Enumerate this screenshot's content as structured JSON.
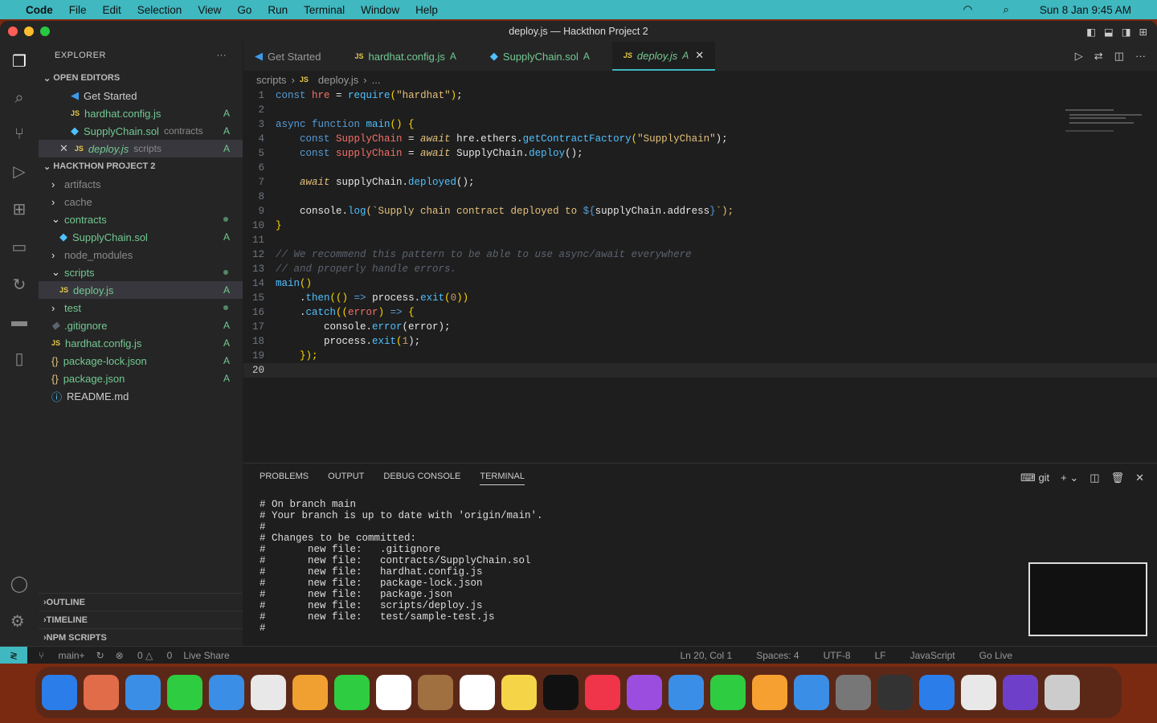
{
  "menubar": {
    "app": "Code",
    "items": [
      "File",
      "Edit",
      "Selection",
      "View",
      "Go",
      "Run",
      "Terminal",
      "Window",
      "Help"
    ],
    "datetime": "Sun 8 Jan  9:45 AM"
  },
  "window": {
    "title": "deploy.js — Hackthon Project 2"
  },
  "explorer": {
    "title": "EXPLORER",
    "open_editors_label": "OPEN EDITORS",
    "open_editors": [
      {
        "name": "Get Started",
        "icon": "vscode-icon",
        "badge": ""
      },
      {
        "name": "hardhat.config.js",
        "icon": "js",
        "badge": "A"
      },
      {
        "name": "SupplyChain.sol",
        "icon": "sol",
        "badge": "A",
        "desc": "contracts"
      },
      {
        "name": "deploy.js",
        "icon": "js",
        "badge": "A",
        "desc": "scripts"
      }
    ],
    "project_label": "HACKTHON PROJECT 2",
    "tree": [
      {
        "name": "artifacts",
        "type": "folder",
        "depth": 1
      },
      {
        "name": "cache",
        "type": "folder",
        "depth": 1
      },
      {
        "name": "contracts",
        "type": "folder-open",
        "depth": 1,
        "dot": true
      },
      {
        "name": "SupplyChain.sol",
        "type": "sol",
        "depth": 2,
        "badge": "A"
      },
      {
        "name": "node_modules",
        "type": "folder",
        "depth": 1
      },
      {
        "name": "scripts",
        "type": "folder-open",
        "depth": 1,
        "dot": true
      },
      {
        "name": "deploy.js",
        "type": "js",
        "depth": 2,
        "badge": "A"
      },
      {
        "name": "test",
        "type": "folder",
        "depth": 1,
        "dot": true
      },
      {
        "name": ".gitignore",
        "type": "git",
        "depth": 1,
        "badge": "A"
      },
      {
        "name": "hardhat.config.js",
        "type": "js",
        "depth": 1,
        "badge": "A"
      },
      {
        "name": "package-lock.json",
        "type": "json",
        "depth": 1,
        "badge": "A"
      },
      {
        "name": "package.json",
        "type": "json",
        "depth": 1,
        "badge": "A"
      },
      {
        "name": "README.md",
        "type": "info",
        "depth": 1
      }
    ],
    "bottom_sections": [
      "OUTLINE",
      "TIMELINE",
      "NPM SCRIPTS"
    ]
  },
  "tabs": [
    {
      "label": "Get Started",
      "icon": "vscode-icon"
    },
    {
      "label": "hardhat.config.js",
      "badge": "A",
      "icon": "js"
    },
    {
      "label": "SupplyChain.sol",
      "badge": "A",
      "icon": "sol"
    },
    {
      "label": "deploy.js",
      "badge": "A",
      "icon": "js",
      "active": true
    }
  ],
  "breadcrumb": [
    "scripts",
    "deploy.js",
    "..."
  ],
  "code": [
    [
      [
        "const ",
        "k"
      ],
      [
        "hre",
        "v"
      ],
      [
        " = ",
        "w"
      ],
      [
        "require",
        "f"
      ],
      [
        "(",
        "p"
      ],
      [
        "\"hardhat\"",
        "s"
      ],
      [
        ")",
        "p"
      ],
      [
        ";",
        "w"
      ]
    ],
    [],
    [
      [
        "async ",
        "k"
      ],
      [
        "function ",
        "k"
      ],
      [
        "main",
        "f"
      ],
      [
        "() {",
        "p"
      ]
    ],
    [
      [
        "    const ",
        "k"
      ],
      [
        "SupplyChain",
        "v"
      ],
      [
        " = ",
        "w"
      ],
      [
        "await ",
        "it"
      ],
      [
        "hre.ethers.",
        "w"
      ],
      [
        "getContractFactory",
        "f"
      ],
      [
        "(",
        "p"
      ],
      [
        "\"SupplyChain\"",
        "s"
      ],
      [
        ");",
        "w"
      ]
    ],
    [
      [
        "    const ",
        "k"
      ],
      [
        "supplyChain",
        "v"
      ],
      [
        " = ",
        "w"
      ],
      [
        "await ",
        "it"
      ],
      [
        "SupplyChain.",
        "w"
      ],
      [
        "deploy",
        "f"
      ],
      [
        "();",
        "w"
      ]
    ],
    [],
    [
      [
        "    await ",
        "it"
      ],
      [
        "supplyChain.",
        "w"
      ],
      [
        "deployed",
        "f"
      ],
      [
        "();",
        "w"
      ]
    ],
    [],
    [
      [
        "    console.",
        "w"
      ],
      [
        "log",
        "f"
      ],
      [
        "(`Supply chain contract deployed to ",
        "s"
      ],
      [
        "${",
        "k"
      ],
      [
        "supplyChain.address",
        "w"
      ],
      [
        "}",
        "k"
      ],
      [
        "`);",
        "s"
      ]
    ],
    [
      [
        "}",
        "p"
      ]
    ],
    [],
    [
      [
        "// We recommend this pattern to be able to use async/await everywhere",
        "c"
      ]
    ],
    [
      [
        "// and properly handle errors.",
        "c"
      ]
    ],
    [
      [
        "main",
        "f"
      ],
      [
        "()",
        "p"
      ]
    ],
    [
      [
        "    .",
        "w"
      ],
      [
        "then",
        "f"
      ],
      [
        "(() ",
        "p"
      ],
      [
        "=> ",
        "k"
      ],
      [
        "process.",
        "w"
      ],
      [
        "exit",
        "f"
      ],
      [
        "(",
        "p"
      ],
      [
        "0",
        "n"
      ],
      [
        "))",
        "p"
      ]
    ],
    [
      [
        "    .",
        "w"
      ],
      [
        "catch",
        "f"
      ],
      [
        "((",
        "p"
      ],
      [
        "error",
        "v"
      ],
      [
        ") ",
        "p"
      ],
      [
        "=> ",
        "k"
      ],
      [
        "{",
        "p"
      ]
    ],
    [
      [
        "        console.",
        "w"
      ],
      [
        "error",
        "f"
      ],
      [
        "(error);",
        "w"
      ]
    ],
    [
      [
        "        process.",
        "w"
      ],
      [
        "exit",
        "f"
      ],
      [
        "(",
        "p"
      ],
      [
        "1",
        "n"
      ],
      [
        ");",
        "w"
      ]
    ],
    [
      [
        "    });",
        "p"
      ]
    ],
    []
  ],
  "panel": {
    "tabs": [
      "PROBLEMS",
      "OUTPUT",
      "DEBUG CONSOLE",
      "TERMINAL"
    ],
    "active": "TERMINAL",
    "shell": "git",
    "terminal": [
      "# On branch main",
      "# Your branch is up to date with 'origin/main'.",
      "#",
      "# Changes to be committed:",
      "#       new file:   .gitignore",
      "#       new file:   contracts/SupplyChain.sol",
      "#       new file:   hardhat.config.js",
      "#       new file:   package-lock.json",
      "#       new file:   package.json",
      "#       new file:   scripts/deploy.js",
      "#       new file:   test/sample-test.js",
      "#"
    ]
  },
  "status": {
    "branch": "main+",
    "errors": "0",
    "warnings": "0",
    "live_share": "Live Share",
    "position": "Ln 20, Col 1",
    "spaces": "Spaces: 4",
    "encoding": "UTF-8",
    "eol": "LF",
    "language": "JavaScript",
    "golive": "Go Live"
  },
  "colors": {
    "accent": "#3fb8c0",
    "git_added": "#73c991"
  }
}
